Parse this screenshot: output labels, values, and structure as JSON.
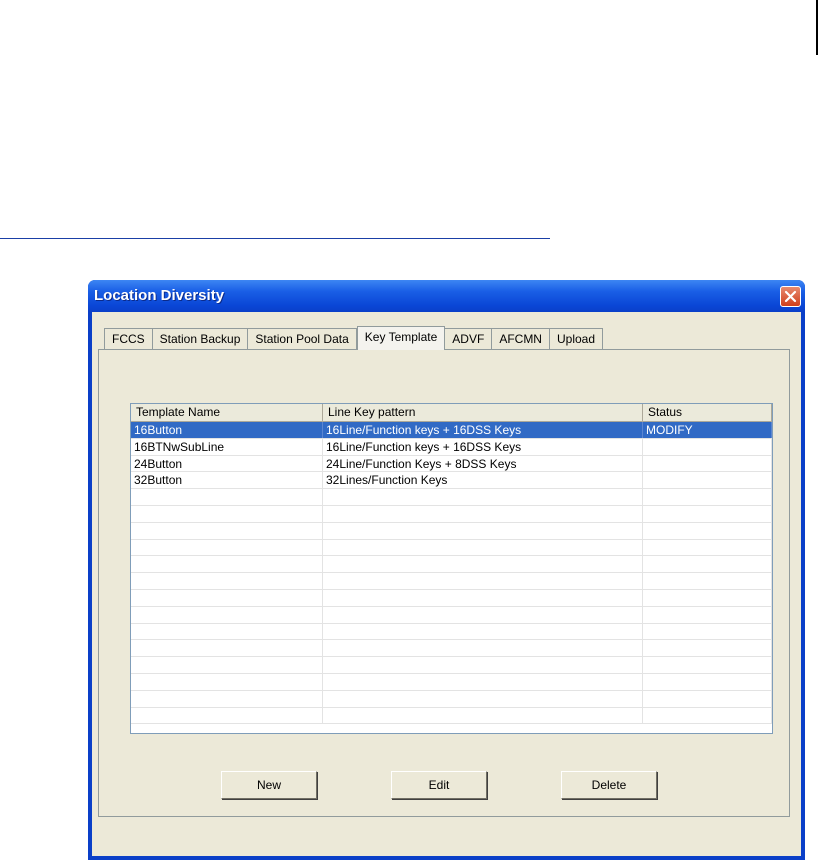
{
  "window": {
    "title": "Location Diversity"
  },
  "tabs": [
    "FCCS",
    "Station Backup",
    "Station Pool Data",
    "Key Template",
    "ADVF",
    "AFCMN",
    "Upload"
  ],
  "active_tab": "Key Template",
  "list": {
    "columns": [
      "Template Name",
      "Line Key pattern",
      "Status"
    ],
    "rows": [
      [
        "16Button",
        "16Line/Function keys + 16DSS Keys",
        "MODIFY"
      ],
      [
        "16BTNwSubLine",
        "16Line/Function keys + 16DSS Keys",
        ""
      ],
      [
        "24Button",
        "24Line/Function Keys + 8DSS Keys",
        ""
      ],
      [
        "32Button",
        "32Lines/Function Keys",
        ""
      ]
    ],
    "selected_row": 0
  },
  "buttons": {
    "new": "New",
    "edit": "Edit",
    "delete": "Delete"
  },
  "colors": {
    "selection": "#316ac5",
    "titlebar": "#0a46d6",
    "close_button": "#cf3f1c"
  },
  "icons": {
    "close": "close-icon"
  }
}
